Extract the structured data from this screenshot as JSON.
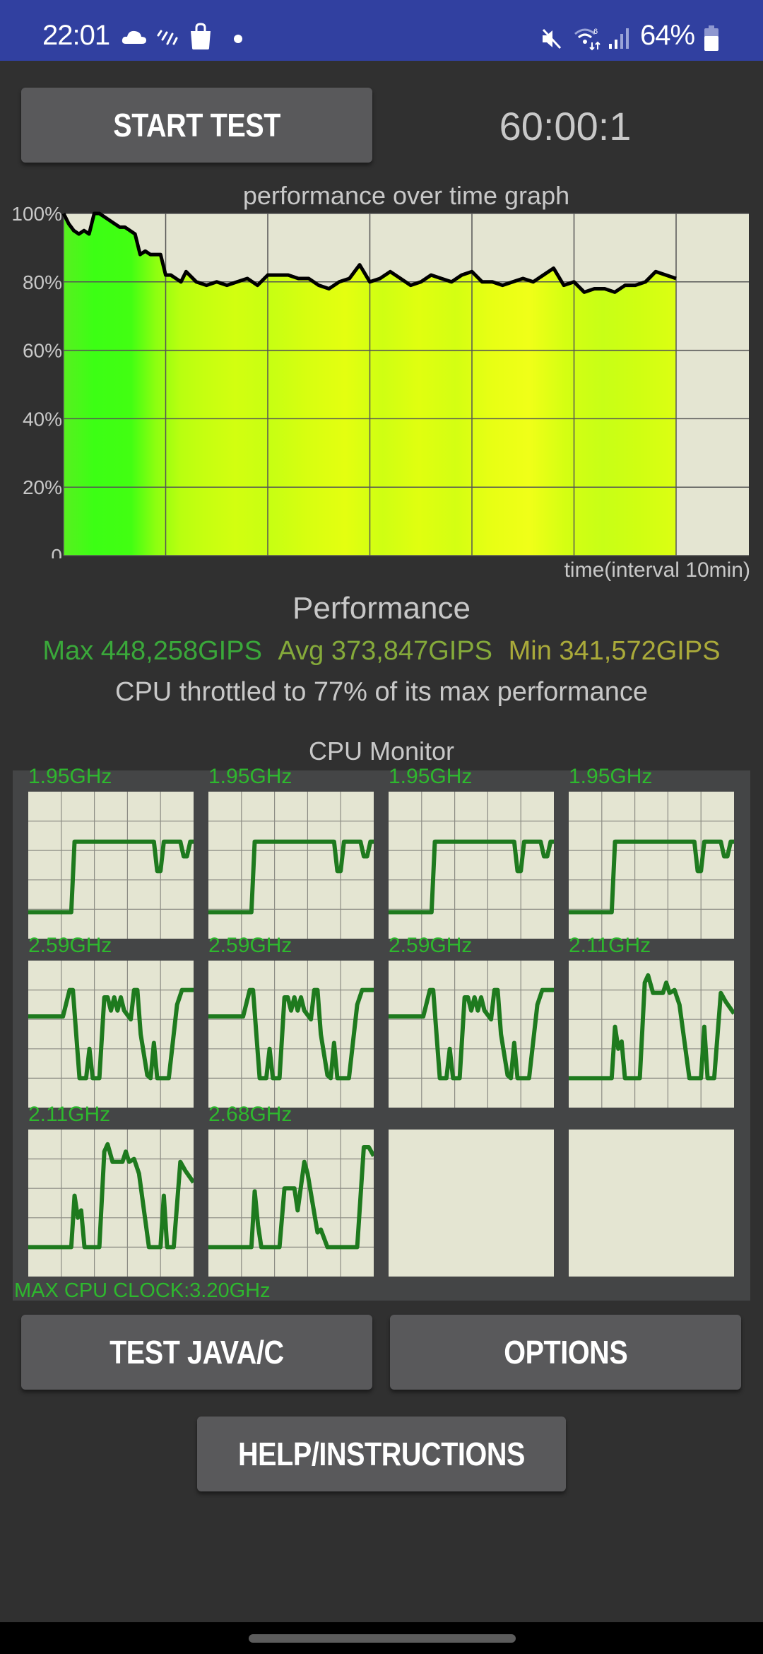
{
  "status_bar": {
    "time": "22:01",
    "left_icons": [
      "cloud-icon",
      "rain-icon",
      "shopping-bag-icon",
      "dot-icon"
    ],
    "right_icons": [
      "mute-icon",
      "wifi6-icon",
      "signal-icon",
      "battery-icon"
    ],
    "battery": "64%",
    "color": "#3140a0"
  },
  "controls": {
    "start_test": "START TEST",
    "timer": "60:00:1"
  },
  "graph": {
    "title": "performance over time graph",
    "x_label": "time(interval 10min)"
  },
  "performance": {
    "heading": "Performance",
    "max": "Max 448,258GIPS",
    "avg": "Avg 373,847GIPS",
    "min": "Min 341,572GIPS",
    "throttle_text": "CPU throttled to 77% of its max performance",
    "colors": {
      "max": "#3aa83a",
      "avg": "#85aa3a",
      "min": "#aaaa3a"
    }
  },
  "cpu_monitor": {
    "heading": "CPU Monitor",
    "max_clock": "MAX CPU CLOCK:3.20GHz",
    "line_color": "#1e7a1e",
    "label_color": "#2eb82e",
    "cores": [
      {
        "label": "1.95GHz",
        "values": [
          0.2,
          0.2,
          0.2,
          0.2,
          0.2,
          0.2,
          0.2,
          0.2,
          0.2,
          0.2,
          0.2,
          0.2,
          0.2,
          0.2,
          0.2,
          0.2,
          0.2,
          0.2,
          0.2,
          0.2,
          0.2,
          0.2,
          0.2,
          0.2,
          0.2,
          0.2,
          0.6,
          0.6,
          0.6,
          0.6,
          0.6,
          0.6,
          0.6,
          0.6,
          0.6,
          0.6,
          0.6,
          0.6,
          0.6,
          0.6,
          0.6,
          0.6,
          0.6,
          0.6,
          0.6,
          0.6,
          0.6,
          0.6,
          0.6,
          0.6,
          0.6,
          0.6,
          0.6,
          0.6,
          0.6,
          0.6,
          0.6,
          0.6,
          0.6,
          0.6,
          0.6,
          0.6,
          0.6,
          0.6,
          0.6,
          0.6,
          0.6,
          0.6,
          0.6,
          0.6,
          0.6,
          0.6,
          0.6,
          0.6,
          0.6,
          0.6,
          0.6,
          0.6,
          0.6,
          0.6,
          0.6,
          0.6,
          0.6,
          0.6,
          0.6,
          0.6,
          0.6,
          0.6,
          0.6,
          0.6,
          0.6,
          0.6,
          0.6,
          0.6,
          0.6,
          0.6,
          0.6,
          0.6,
          0.6,
          0.6
        ]
      },
      {
        "label": "1.95GHz"
      },
      {
        "label": "1.95GHz"
      },
      {
        "label": "1.95GHz"
      },
      {
        "label": "2.59GHz"
      },
      {
        "label": "2.59GHz"
      },
      {
        "label": "2.59GHz"
      },
      {
        "label": "2.11GHz"
      },
      {
        "label": "2.11GHz"
      },
      {
        "label": "2.68GHz"
      },
      {
        "label": ""
      },
      {
        "label": ""
      }
    ]
  },
  "buttons": {
    "test_java_c": "TEST JAVA/C",
    "options": "OPTIONS",
    "help": "HELP/INSTRUCTIONS"
  },
  "chart_data": [
    {
      "type": "area",
      "title": "performance over time graph",
      "xlabel": "time(interval 10min)",
      "ylabel": "",
      "y_ticks": [
        "0",
        "20%",
        "40%",
        "60%",
        "80%",
        "100%"
      ],
      "ylim": [
        0,
        100
      ],
      "xlim_minutes": [
        0,
        70
      ],
      "x_grid_interval_minutes": 10,
      "grid": true,
      "x_minutes": [
        0,
        0.5,
        1,
        1.5,
        2,
        2.5,
        3,
        3.5,
        4,
        4.5,
        5,
        5.5,
        6,
        6.5,
        7,
        7.5,
        8,
        8.5,
        9,
        9.5,
        10,
        10.5,
        11,
        11.5,
        12,
        13,
        14,
        15,
        16,
        17,
        18,
        19,
        20,
        21,
        22,
        23,
        24,
        25,
        26,
        27,
        28,
        29,
        30,
        31,
        32,
        33,
        34,
        35,
        36,
        37,
        38,
        39,
        40,
        41,
        42,
        43,
        44,
        45,
        46,
        47,
        48,
        49,
        50,
        51,
        52,
        53,
        54,
        55,
        56,
        57,
        58,
        59,
        60
      ],
      "values": [
        100,
        97,
        95,
        94,
        95,
        94,
        100,
        100,
        99,
        98,
        97,
        96,
        96,
        95,
        94,
        88,
        89,
        88,
        88,
        88,
        82,
        82,
        81,
        80,
        83,
        80,
        79,
        80,
        79,
        80,
        81,
        79,
        82,
        82,
        82,
        81,
        81,
        79,
        78,
        80,
        81,
        85,
        80,
        81,
        83,
        81,
        79,
        80,
        82,
        81,
        80,
        82,
        83,
        80,
        80,
        79,
        80,
        81,
        80,
        82,
        84,
        79,
        80,
        77,
        78,
        78,
        77,
        79,
        79,
        80,
        83,
        82,
        81,
        83
      ]
    }
  ]
}
